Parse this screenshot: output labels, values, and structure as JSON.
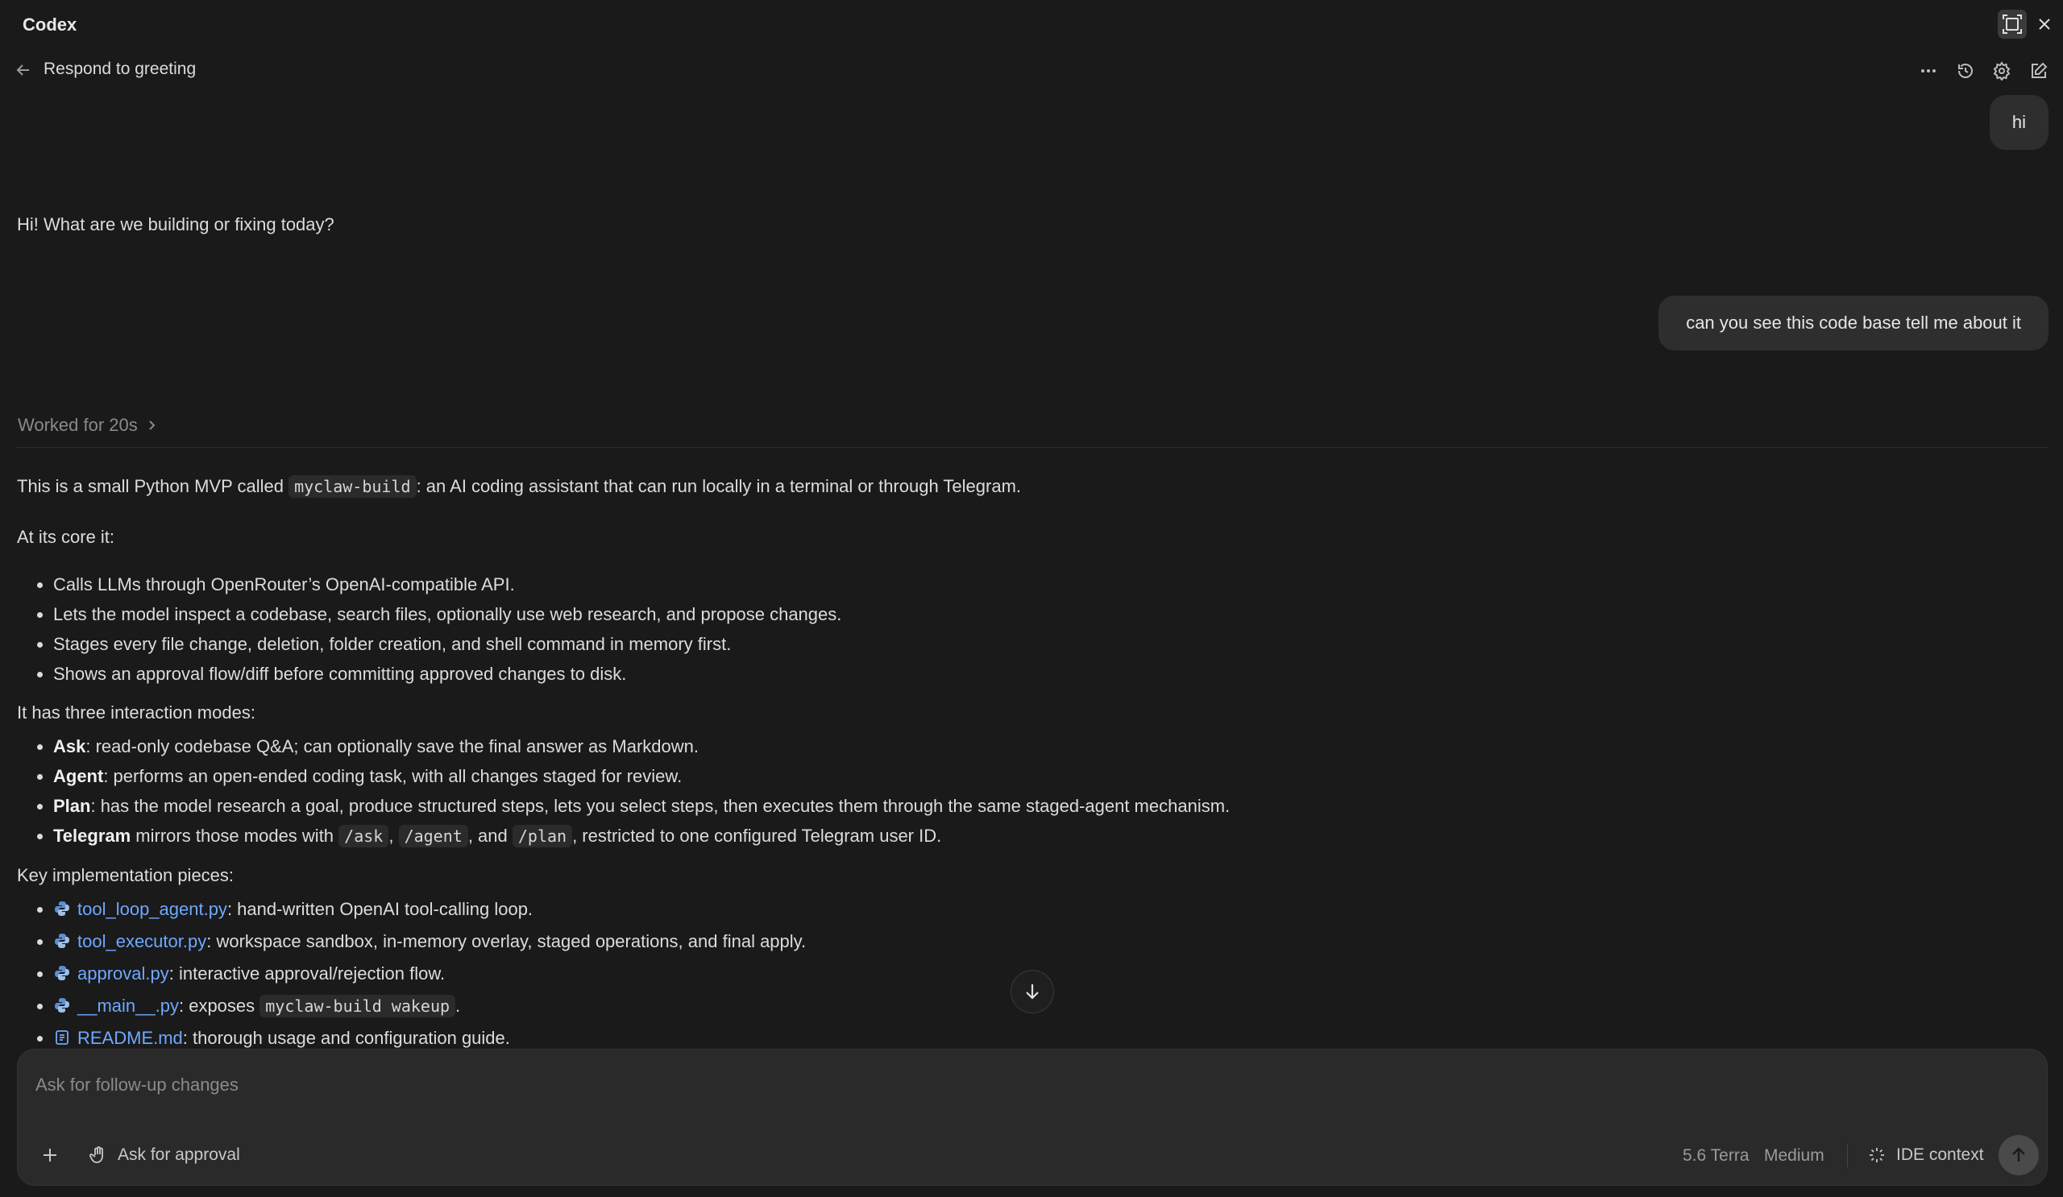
{
  "window": {
    "app_title": "Codex"
  },
  "header": {
    "title": "Respond to greeting",
    "icons": [
      "more-icon",
      "history-icon",
      "settings-icon",
      "new-chat-icon"
    ]
  },
  "messages": {
    "user1": "hi",
    "assistant1": "Hi! What are we building or fixing today?",
    "user2": "can you see this code base tell me about it",
    "worked": "Worked for 20s",
    "intro_pre": "This is a small Python MVP called ",
    "intro_code": "myclaw-build",
    "intro_post": ": an AI coding assistant that can run locally in a terminal or through Telegram.",
    "core_heading": "At its core it:",
    "core_items": [
      "Calls LLMs through OpenRouter’s OpenAI-compatible API.",
      "Lets the model inspect a codebase, search files, optionally use web research, and propose changes.",
      "Stages every file change, deletion, folder creation, and shell command in memory first.",
      "Shows an approval flow/diff before committing approved changes to disk."
    ],
    "modes_heading": "It has three interaction modes:",
    "modes": {
      "ask_label": "Ask",
      "ask_text": ": read-only codebase Q&A; can optionally save the final answer as Markdown.",
      "agent_label": "Agent",
      "agent_text": ": performs an open-ended coding task, with all changes staged for review.",
      "plan_label": "Plan",
      "plan_text": ": has the model research a goal, produce structured steps, lets you select steps, then executes them through the same staged-agent mechanism.",
      "telegram_label": "Telegram",
      "telegram_pre": " mirrors those modes with ",
      "cmd_ask": "/ask",
      "comma": ", ",
      "cmd_agent": "/agent",
      "and": ", and ",
      "cmd_plan": "/plan",
      "telegram_post": ", restricted to one configured Telegram user ID."
    },
    "pieces_heading": "Key implementation pieces:",
    "pieces": [
      {
        "file": "tool_loop_agent.py",
        "text": ": hand-written OpenAI tool-calling loop."
      },
      {
        "file": "tool_executor.py",
        "text": ": workspace sandbox, in-memory overlay, staged operations, and final apply."
      },
      {
        "file": "approval.py",
        "text": ": interactive approval/rejection flow."
      },
      {
        "file": "__main__.py",
        "text_pre": ": exposes ",
        "code": "myclaw-build wakeup",
        "text_post": "."
      },
      {
        "file": "README.md",
        "text": ": thorough usage and configuration guide."
      }
    ]
  },
  "composer": {
    "placeholder": "Ask for follow-up changes",
    "approval_label": "Ask for approval",
    "model": "5.6 Terra",
    "effort": "Medium",
    "ide_context": "IDE context"
  },
  "colors": {
    "background": "#1a1a1a",
    "link": "#6ea8ff",
    "bubble": "#2e2e2e"
  }
}
